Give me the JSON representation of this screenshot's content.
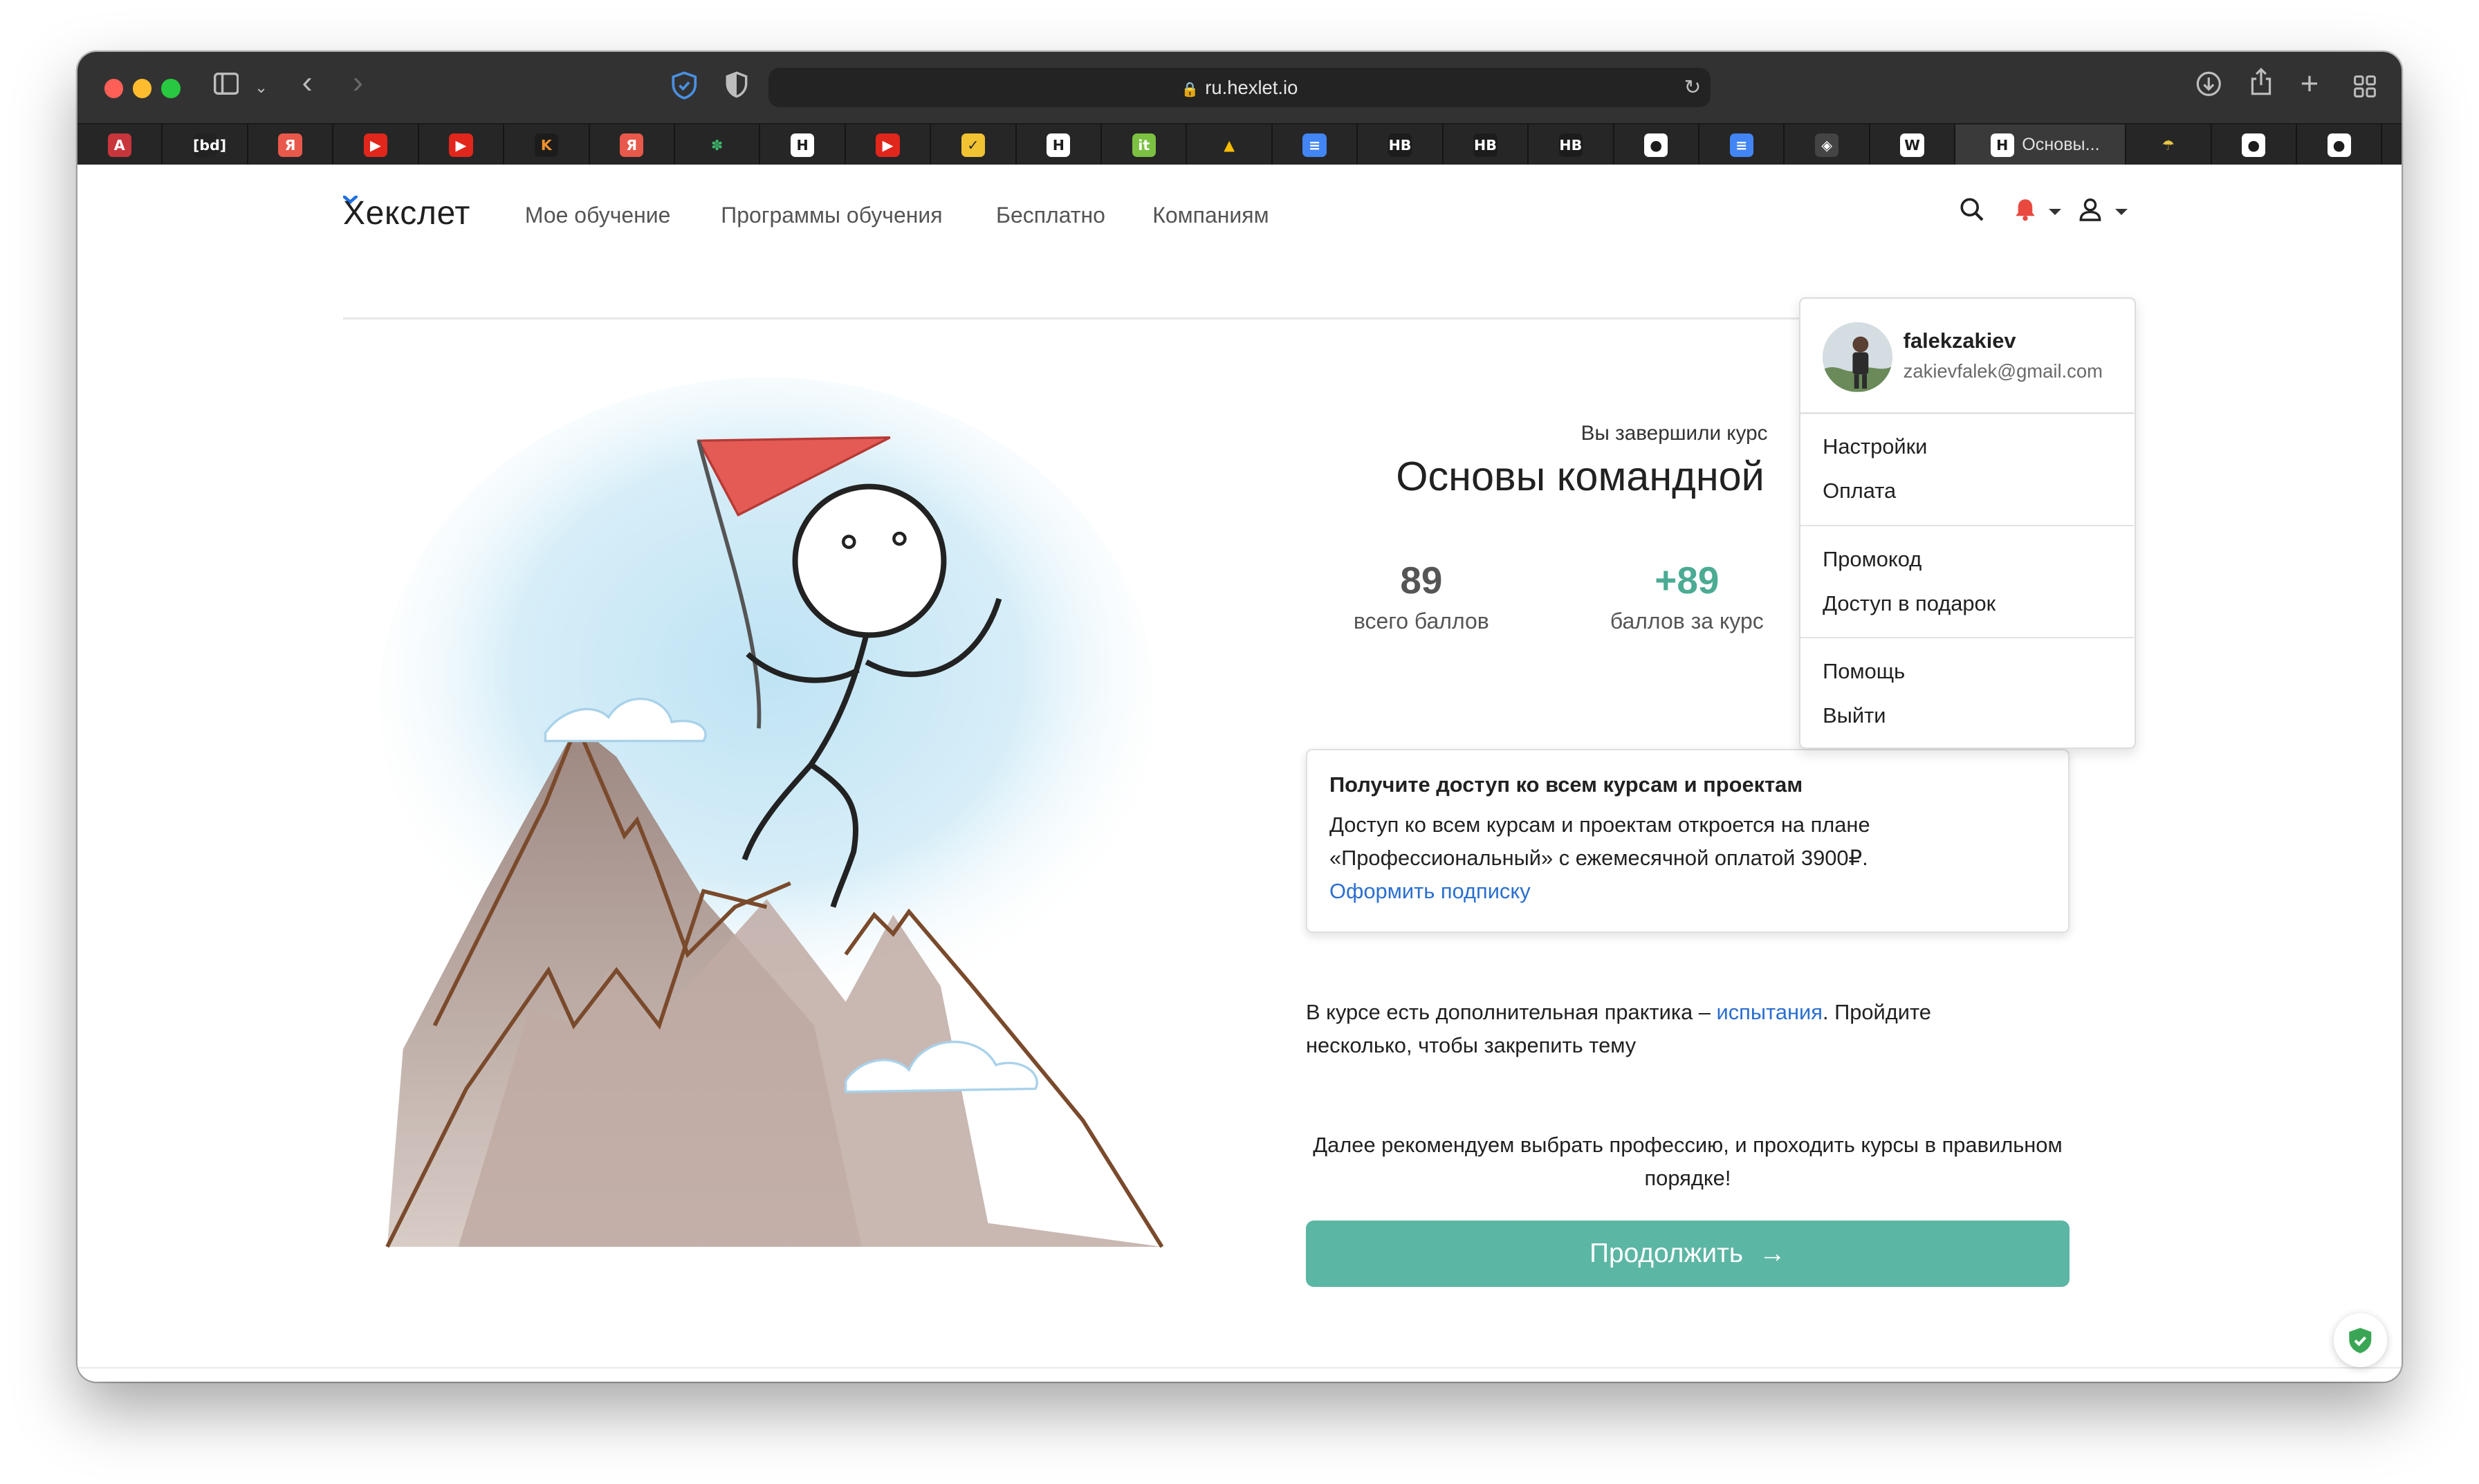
{
  "browser": {
    "url": "ru.hexlet.io",
    "active_tab_label": "Основы..."
  },
  "favorites": [
    {
      "icon": "A",
      "fg": "#ffffff",
      "bg": "#c8363b"
    },
    {
      "icon": "[bd]",
      "fg": "#ffffff",
      "bg": "#222222"
    },
    {
      "icon": "Я",
      "fg": "#ffffff",
      "bg": "#e8584b"
    },
    {
      "icon": "▶",
      "fg": "#ffffff",
      "bg": "#e1261c"
    },
    {
      "icon": "▶",
      "fg": "#ffffff",
      "bg": "#e1261c"
    },
    {
      "icon": "K",
      "fg": "#f1922c",
      "bg": "#1c1c1c"
    },
    {
      "icon": "Я",
      "fg": "#ffffff",
      "bg": "#e8584b"
    },
    {
      "icon": "✽",
      "fg": "#3db66a",
      "bg": "#262626"
    },
    {
      "icon": "H",
      "fg": "#1c1c1c",
      "bg": "#ffffff"
    },
    {
      "icon": "▶",
      "fg": "#ffffff",
      "bg": "#e1261c"
    },
    {
      "icon": "✓",
      "fg": "#2e2e2e",
      "bg": "#f1c232"
    },
    {
      "icon": "H",
      "fg": "#1c1c1c",
      "bg": "#ffffff"
    },
    {
      "icon": "it",
      "fg": "#ffffff",
      "bg": "#7cc142"
    },
    {
      "icon": "▲",
      "fg": "#fbbc04",
      "bg": "#262626"
    },
    {
      "icon": "≡",
      "fg": "#ffffff",
      "bg": "#4285f4"
    },
    {
      "icon": "HB",
      "fg": "#ffffff",
      "bg": "#1c1c1c"
    },
    {
      "icon": "HB",
      "fg": "#ffffff",
      "bg": "#1c1c1c"
    },
    {
      "icon": "HB",
      "fg": "#ffffff",
      "bg": "#1c1c1c"
    },
    {
      "icon": "●",
      "fg": "#1c1c1c",
      "bg": "#ffffff"
    },
    {
      "icon": "≡",
      "fg": "#ffffff",
      "bg": "#4285f4"
    },
    {
      "icon": "◈",
      "fg": "#ffffff",
      "bg": "#444444"
    },
    {
      "icon": "W",
      "fg": "#1c1c1c",
      "bg": "#ffffff"
    }
  ],
  "favorites_after": [
    {
      "icon": "☂",
      "fg": "#e8c547",
      "bg": "#262626"
    },
    {
      "icon": "●",
      "fg": "#1c1c1c",
      "bg": "#ffffff"
    },
    {
      "icon": "●",
      "fg": "#1c1c1c",
      "bg": "#ffffff"
    },
    {
      "icon": "●",
      "fg": "#1c1c1c",
      "bg": "#ffffff"
    }
  ],
  "header": {
    "logo": "Хекслет",
    "nav": [
      "Мое обучение",
      "Программы обучения",
      "Бесплатно",
      "Компаниям"
    ]
  },
  "course": {
    "completed_label": "Вы завершили курс",
    "title": "Основы командной"
  },
  "stats": {
    "total_value": "89",
    "total_label": "всего баллов",
    "earned_value": "+89",
    "earned_label": "баллов за курс",
    "earned_color": "#4bab93",
    "total_color": "#555555"
  },
  "promo": {
    "title": "Получите доступ ко всем курсам и проектам",
    "text": "Доступ ко всем курсам и проектам откроется на плане «Профессиональный» с ежемесячной оплатой 3900₽.",
    "link": "Оформить подписку"
  },
  "practice": {
    "text_before": "В курсе есть дополнительная практика – ",
    "link": "испытания",
    "text_after": ". Пройдите несколько, чтобы закрепить тему"
  },
  "recommend": "Далее рекомендуем выбрать профессию, и проходить курсы в правильном порядке!",
  "continue_label": "Продолжить",
  "user_menu": {
    "username": "falekzakiev",
    "email": "zakievfalek@gmail.com",
    "settings": "Настройки",
    "payment": "Оплата",
    "promo_code": "Промокод",
    "gift_access": "Доступ в подарок",
    "help": "Помощь",
    "logout": "Выйти"
  },
  "colors": {
    "accent": "#5cb6a4",
    "link": "#2a6fcf",
    "bell": "#e9493f"
  }
}
